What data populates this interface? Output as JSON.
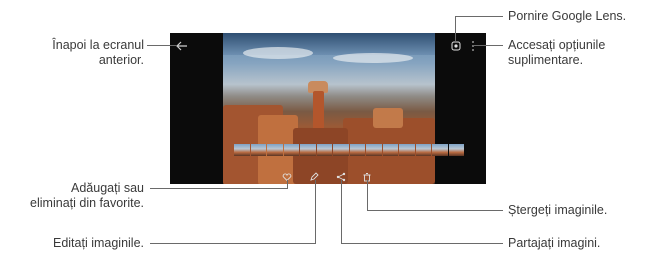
{
  "callouts": {
    "back": {
      "line1": "Înapoi la ecranul",
      "line2": "anterior."
    },
    "lens": "Pornire Google Lens.",
    "more": {
      "line1": "Accesați opțiunile",
      "line2": "suplimentare."
    },
    "favorite": {
      "line1": "Adăugați sau",
      "line2": "eliminați din favorite."
    },
    "delete": "Ștergeți imaginile.",
    "edit": "Editați imaginile.",
    "share": "Partajați imagini."
  },
  "icons": {
    "back": "back-arrow-icon",
    "lens": "google-lens-icon",
    "more": "more-options-icon",
    "favorite": "favorite-icon",
    "edit": "edit-pencil-icon",
    "share": "share-icon",
    "delete": "delete-trash-icon"
  },
  "colors": {
    "screen_bg": "#0b0b0b",
    "leader_line": "#6a6a6a",
    "text": "#3a3a3a"
  }
}
